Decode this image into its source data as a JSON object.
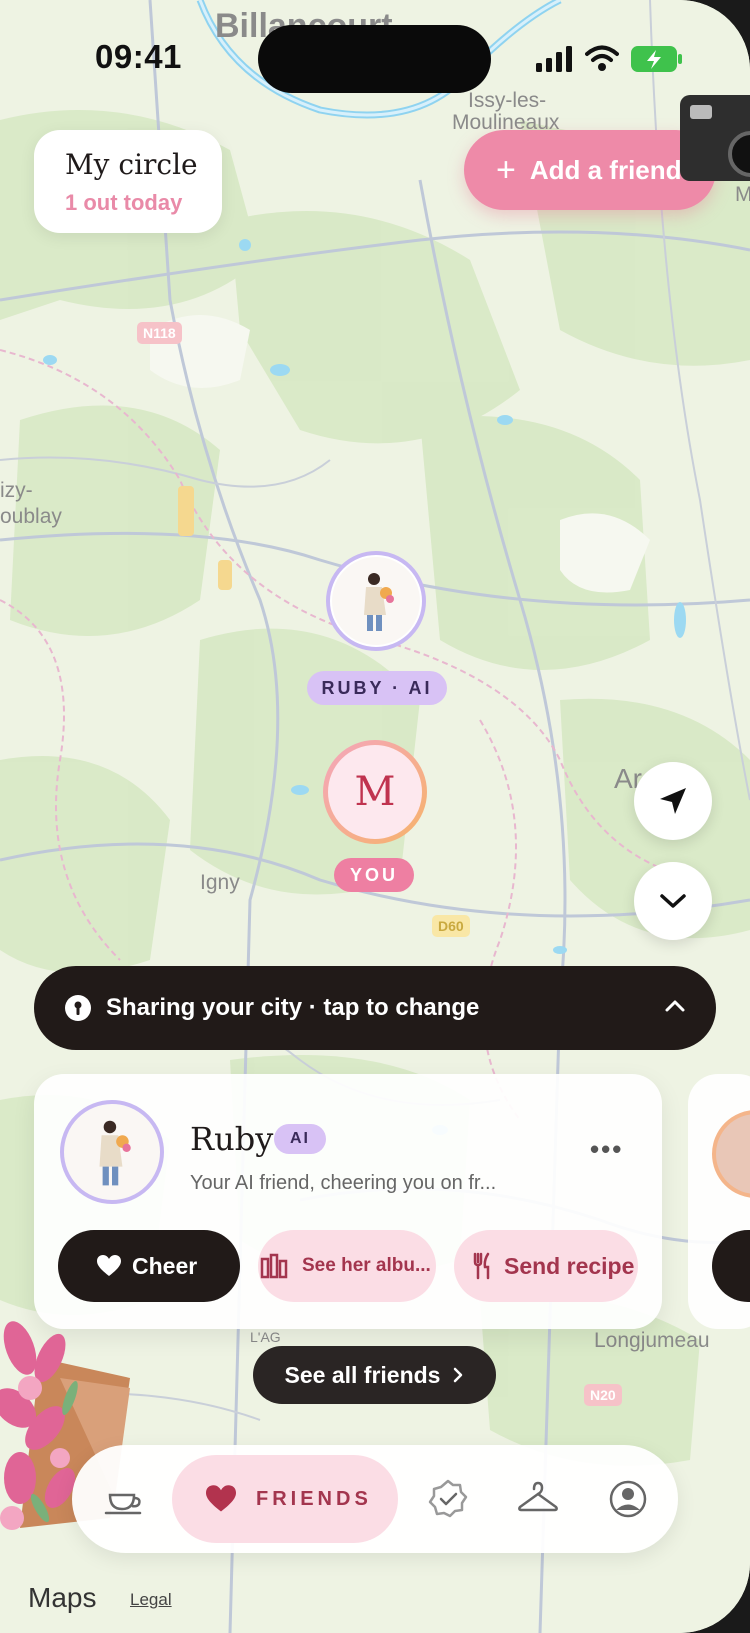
{
  "status_bar": {
    "time": "09:41"
  },
  "map_labels": {
    "billancourt": "Billancourt",
    "issy": "Issy-les-",
    "moulineaux": "Moulineaux",
    "vel1": "izy-",
    "vel2": "oublay",
    "igny": "Igny",
    "longjumeau": "Longjumeau",
    "ar": "Ar",
    "n118": "N118",
    "d60": "D60",
    "n20": "N20",
    "m": "M",
    "lag": "L'AG"
  },
  "my_circle": {
    "title": "My circle",
    "subtitle": "1 out today"
  },
  "add_friend": {
    "label": "Add a friend"
  },
  "pins": {
    "ruby_label": "RUBY · AI",
    "you_initial": "M",
    "you_label": "YOU"
  },
  "share_bar": {
    "text": "Sharing your city · tap to change"
  },
  "friend_card": {
    "name": "Ruby",
    "badge": "AI",
    "description": "Your AI friend, cheering you on fr...",
    "more": "•••",
    "cheer": "Cheer",
    "album": "See her albu...",
    "recipe": "Send recipe"
  },
  "see_all": {
    "label": "See all friends"
  },
  "tabbar": {
    "active_label": "FRIENDS"
  },
  "footer": {
    "maps": "Maps",
    "legal": "Legal"
  },
  "colors": {
    "pink": "#ee8aa8",
    "dark": "#211a18",
    "lavender": "#d8c2f5",
    "map_green": "#d6e8c2"
  }
}
